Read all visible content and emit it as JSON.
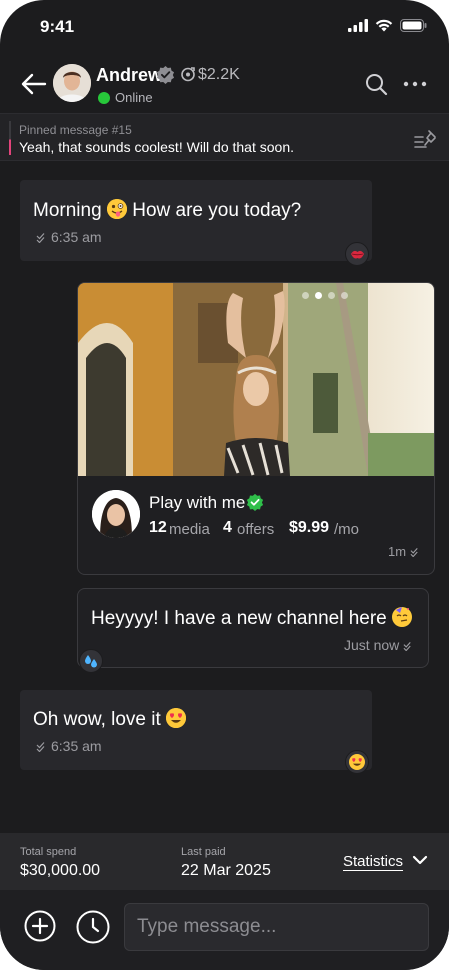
{
  "status_bar": {
    "time": "9:41"
  },
  "header": {
    "name": "Andrew",
    "earnings": "$2.2K",
    "presence": "Online"
  },
  "pinned": {
    "title": "Pinned message #15",
    "text": "Yeah, that sounds coolest! Will do that soon."
  },
  "messages": [
    {
      "text": "Morning",
      "text_after_emoji": "How are you today?",
      "time": "6:35 am",
      "reaction": "kiss-mark"
    },
    {
      "text": "Heyyyy! I have a new channel here",
      "time": "Just now",
      "reaction": "sweat-droplets"
    },
    {
      "text": "Oh wow, love it",
      "time": "6:35 am",
      "reaction": "heart-eyes"
    }
  ],
  "channel_card": {
    "name": "Play with me",
    "media_count": "12",
    "media_label": "media",
    "offers_count": "4",
    "offers_label": "offers",
    "price": "$9.99",
    "price_unit": "/mo",
    "time": "1m",
    "slides": 4,
    "active_slide": 1
  },
  "summary": {
    "total_label": "Total spend",
    "total_value": "$30,000.00",
    "last_paid_label": "Last paid",
    "last_paid_value": "22 Mar 2025",
    "statistics_label": "Statistics"
  },
  "composer": {
    "placeholder": "Type message..."
  },
  "colors": {
    "background": "#1c1c1e",
    "bubble": "#28282c",
    "online": "#27c73a",
    "verified": "#2fbf4a",
    "pin_accent": "#e2447b"
  }
}
